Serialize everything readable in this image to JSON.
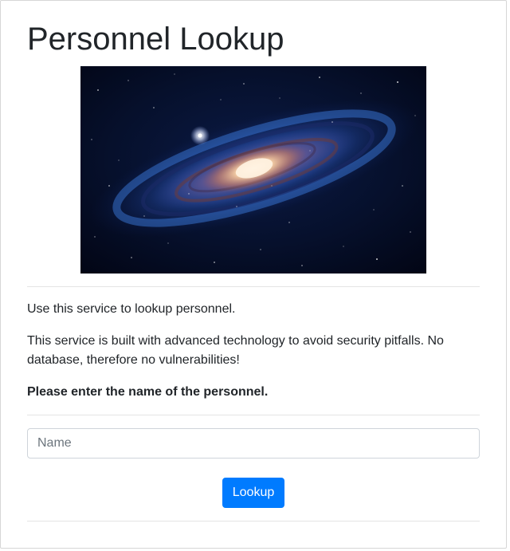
{
  "page": {
    "title": "Personnel Lookup"
  },
  "hero_image": {
    "icon": "galaxy-image",
    "colors": {
      "space": "#04071a",
      "outer_arm": "#1f47a8",
      "mid_arm": "#3a78d8",
      "dust": "#a35f47",
      "core": "#f3c9a6"
    }
  },
  "content": {
    "intro": "Use this service to lookup personnel.",
    "description": "This service is built with advanced technology to avoid security pitfalls. No database, therefore no vulnerabilities!",
    "instruction": "Please enter the name of the personnel."
  },
  "form": {
    "name_placeholder": "Name",
    "name_value": "",
    "submit_label": "Lookup"
  },
  "colors": {
    "primary": "#007bff",
    "text": "#212529",
    "divider": "#e4e4e4"
  }
}
